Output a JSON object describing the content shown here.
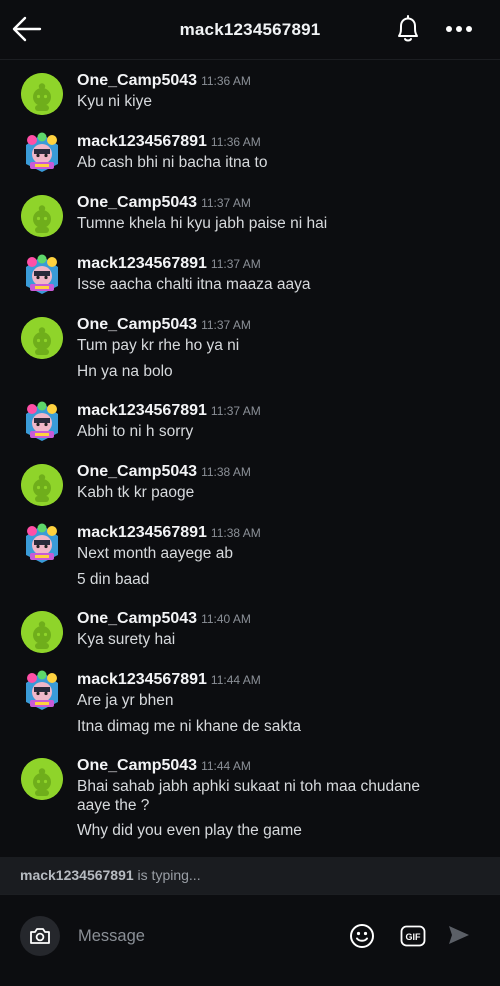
{
  "header": {
    "title": "mack1234567891",
    "icons": {
      "back": "arrow-left-icon",
      "notifications": "bell-icon",
      "more": "more-horizontal-icon"
    }
  },
  "messages": [
    {
      "author": "One_Camp5043",
      "avatar": "green-snoo-avatar",
      "time": "11:36 AM",
      "lines": [
        "Kyu ni kiye"
      ]
    },
    {
      "author": "mack1234567891",
      "avatar": "rainbow-snoo-avatar",
      "time": "11:36 AM",
      "lines": [
        "Ab cash bhi ni bacha itna to"
      ]
    },
    {
      "author": "One_Camp5043",
      "avatar": "green-snoo-avatar",
      "time": "11:37 AM",
      "lines": [
        "Tumne khela hi kyu jabh paise ni hai"
      ]
    },
    {
      "author": "mack1234567891",
      "avatar": "rainbow-snoo-avatar",
      "time": "11:37 AM",
      "lines": [
        "Isse aacha chalti itna maaza aaya"
      ]
    },
    {
      "author": "One_Camp5043",
      "avatar": "green-snoo-avatar",
      "time": "11:37 AM",
      "lines": [
        "Tum pay kr rhe ho ya ni",
        "Hn ya na bolo"
      ]
    },
    {
      "author": "mack1234567891",
      "avatar": "rainbow-snoo-avatar",
      "time": "11:37 AM",
      "lines": [
        "Abhi to ni h sorry"
      ]
    },
    {
      "author": "One_Camp5043",
      "avatar": "green-snoo-avatar",
      "time": "11:38 AM",
      "lines": [
        "Kabh tk kr paoge"
      ]
    },
    {
      "author": "mack1234567891",
      "avatar": "rainbow-snoo-avatar",
      "time": "11:38 AM",
      "lines": [
        "Next month aayege ab",
        "5 din baad"
      ]
    },
    {
      "author": "One_Camp5043",
      "avatar": "green-snoo-avatar",
      "time": "11:40 AM",
      "lines": [
        "Kya surety hai"
      ]
    },
    {
      "author": "mack1234567891",
      "avatar": "rainbow-snoo-avatar",
      "time": "11:44 AM",
      "lines": [
        "Are ja yr bhen",
        "Itna dimag me ni khane de sakta"
      ]
    },
    {
      "author": "One_Camp5043",
      "avatar": "green-snoo-avatar",
      "time": "11:44 AM",
      "lines": [
        "Bhai sahab jabh aphki sukaat ni toh maa chudane",
        "aaye the ?",
        "Why did you even play the game"
      ]
    }
  ],
  "typing": {
    "user": "mack1234567891",
    "text": " is typing..."
  },
  "composer": {
    "placeholder": "Message",
    "icons": {
      "camera": "camera-icon",
      "emoji": "smiley-icon",
      "gif": "gif-icon",
      "send": "send-icon"
    },
    "gif_label": "GIF"
  },
  "colors": {
    "background": "#0c0d10",
    "green_avatar": "#8fd42a",
    "typing_bar": "#1a1c20",
    "secondary_text": "#8b9097"
  }
}
